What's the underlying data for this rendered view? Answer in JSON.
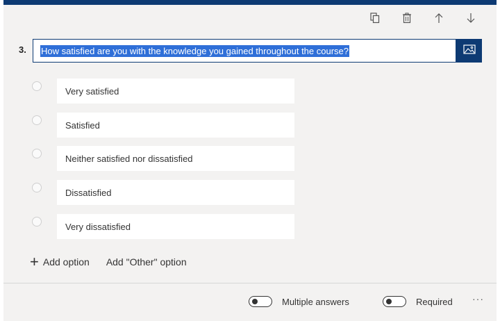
{
  "question": {
    "number": "3.",
    "text": "How satisfied are you with the knowledge you gained throughout the course?"
  },
  "toolbar": {
    "icons": [
      "copy-icon",
      "trash-icon",
      "arrow-up-icon",
      "arrow-down-icon"
    ]
  },
  "options": [
    {
      "label": "Very satisfied"
    },
    {
      "label": "Satisfied"
    },
    {
      "label": "Neither satisfied nor dissatisfied"
    },
    {
      "label": "Dissatisfied"
    },
    {
      "label": "Very dissatisfied"
    }
  ],
  "add": {
    "option_label": "Add option",
    "other_label": "Add \"Other\" option"
  },
  "footer": {
    "multiple_answers_label": "Multiple answers",
    "required_label": "Required",
    "more_label": "···"
  },
  "colors": {
    "accent": "#0d3a73",
    "selection": "#2f6fd8",
    "card_background": "#f3f2f1"
  }
}
